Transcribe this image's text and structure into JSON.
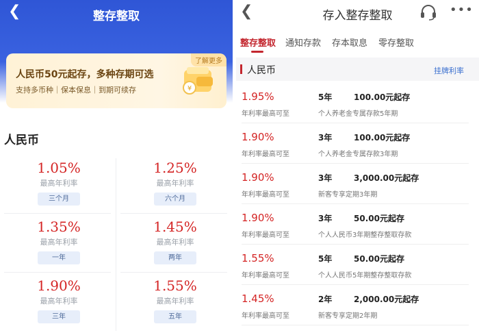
{
  "left": {
    "header": {
      "title": "整存整取"
    },
    "promo": {
      "more_label": "了解更多",
      "title": "人民币50元起存，多种存期可选",
      "subtitle": "支持多币种｜保本保息｜到期可续存"
    },
    "section_title": "人民币",
    "rates": [
      {
        "rate": "1.05%",
        "label": "最高年利率",
        "term": "三个月"
      },
      {
        "rate": "1.25%",
        "label": "最高年利率",
        "term": "六个月"
      },
      {
        "rate": "1.35%",
        "label": "最高年利率",
        "term": "一年"
      },
      {
        "rate": "1.45%",
        "label": "最高年利率",
        "term": "两年"
      },
      {
        "rate": "1.90%",
        "label": "最高年利率",
        "term": "三年"
      },
      {
        "rate": "1.55%",
        "label": "最高年利率",
        "term": "五年"
      }
    ]
  },
  "right": {
    "header": {
      "title": "存入整存整取"
    },
    "tabs": [
      {
        "label": "整存整取",
        "active": true
      },
      {
        "label": "通知存款",
        "active": false
      },
      {
        "label": "存本取息",
        "active": false
      },
      {
        "label": "零存整取",
        "active": false
      }
    ],
    "section": {
      "title": "人民币",
      "link": "挂牌利率"
    },
    "products": [
      {
        "rate": "1.95%",
        "rate_label": "年利率最高可至",
        "term": "5年",
        "min": "100.00元起存",
        "name": "个人养老金专属存款5年期"
      },
      {
        "rate": "1.90%",
        "rate_label": "年利率最高可至",
        "term": "3年",
        "min": "100.00元起存",
        "name": "个人养老金专属存款3年期"
      },
      {
        "rate": "1.90%",
        "rate_label": "年利率最高可至",
        "term": "3年",
        "min": "3,000.00元起存",
        "name": "新客专享定期3年期"
      },
      {
        "rate": "1.90%",
        "rate_label": "年利率最高可至",
        "term": "3年",
        "min": "50.00元起存",
        "name": "个人人民币3年期整存整取存款"
      },
      {
        "rate": "1.55%",
        "rate_label": "年利率最高可至",
        "term": "5年",
        "min": "50.00元起存",
        "name": "个人人民币5年期整存整取存款"
      },
      {
        "rate": "1.45%",
        "rate_label": "年利率最高可至",
        "term": "2年",
        "min": "2,000.00元起存",
        "name": "新客专享定期2年期"
      }
    ]
  },
  "colors": {
    "brand_blue": "#2f56d6",
    "accent_red": "#c3262e",
    "rate_red": "#d42424",
    "link_blue": "#3a6fcf"
  },
  "icons": {
    "back": "chevron-left-icon",
    "service": "headset-icon",
    "more": "more-dots-icon",
    "promo": "wallet-coin-icon"
  }
}
